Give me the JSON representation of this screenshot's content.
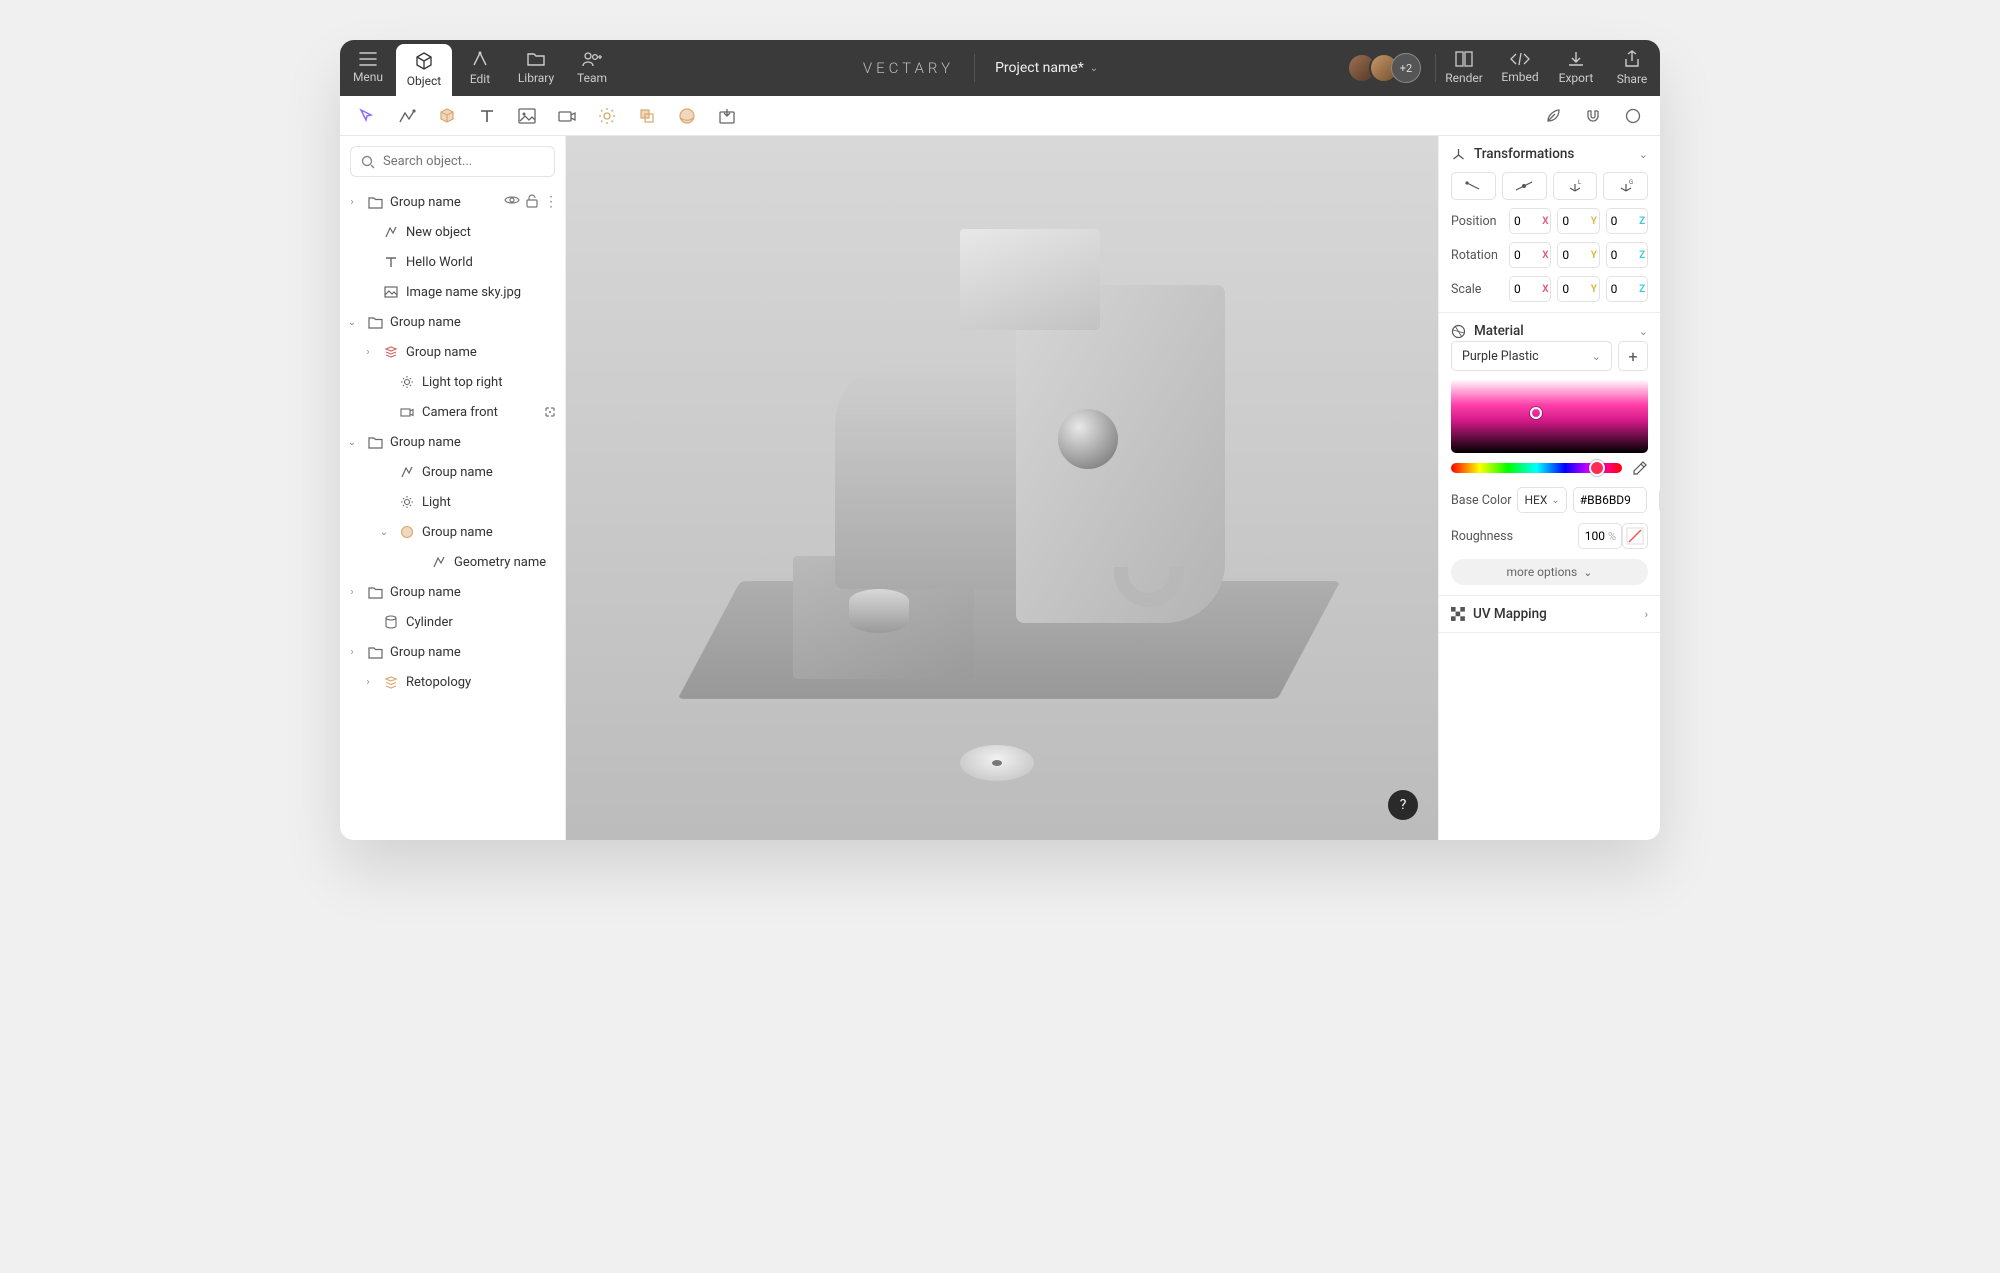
{
  "topbar": {
    "tabs": [
      {
        "label": "Menu"
      },
      {
        "label": "Object"
      },
      {
        "label": "Edit"
      },
      {
        "label": "Library"
      },
      {
        "label": "Team"
      }
    ],
    "brand": "VECTARY",
    "project": "Project name*",
    "avatar_extra": "+2",
    "actions": [
      {
        "label": "Render"
      },
      {
        "label": "Embed"
      },
      {
        "label": "Export"
      },
      {
        "label": "Share"
      }
    ]
  },
  "search": {
    "placeholder": "Search object..."
  },
  "tree": [
    {
      "label": "Group name"
    },
    {
      "label": "New object"
    },
    {
      "label": "Hello World"
    },
    {
      "label": "Image name sky.jpg"
    },
    {
      "label": "Group name"
    },
    {
      "label": "Group name"
    },
    {
      "label": "Light top right"
    },
    {
      "label": "Camera front"
    },
    {
      "label": "Group name"
    },
    {
      "label": "Group name"
    },
    {
      "label": "Light"
    },
    {
      "label": "Group name"
    },
    {
      "label": "Geometry name"
    },
    {
      "label": "Group name"
    },
    {
      "label": "Cylinder"
    },
    {
      "label": "Group name"
    },
    {
      "label": "Retopology"
    }
  ],
  "help": "?",
  "panels": {
    "transformations": {
      "title": "Transformations",
      "position_label": "Position",
      "rotation_label": "Rotation",
      "scale_label": "Scale",
      "position": {
        "x": "0",
        "y": "0",
        "z": "0"
      },
      "rotation": {
        "x": "0",
        "y": "0",
        "z": "0"
      },
      "scale": {
        "x": "0",
        "y": "0",
        "z": "0"
      }
    },
    "material": {
      "title": "Material",
      "selected": "Purple Plastic",
      "base_color_label": "Base Color",
      "color_mode": "HEX",
      "color_value": "#BB6BD9",
      "roughness_label": "Roughness",
      "roughness_value": "100",
      "roughness_unit": "%",
      "more": "more options"
    },
    "uv": {
      "title": "UV Mapping"
    }
  }
}
